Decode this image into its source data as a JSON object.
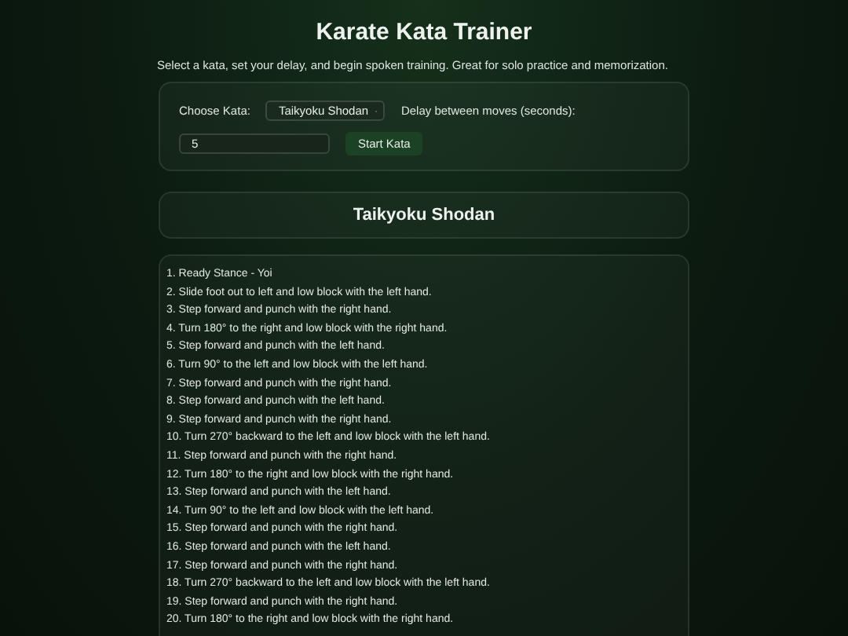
{
  "title": "Karate Kata Trainer",
  "subtitle": "Select a kata, set your delay, and begin spoken training. Great for solo practice and memorization.",
  "controls": {
    "kata_label": "Choose Kata:",
    "kata_value": "Taikyoku Shodan",
    "delay_label": "Delay between moves (seconds):",
    "delay_value": "5",
    "start_button": "Start Kata"
  },
  "kata_heading": "Taikyoku Shodan",
  "moves": [
    "1. Ready Stance - Yoi",
    "2. Slide foot out to left and low block with the left hand.",
    "3. Step forward and punch with the right hand.",
    "4. Turn 180° to the right and low block with the right hand.",
    "5. Step forward and punch with the left hand.",
    "6. Turn 90° to the left and low block with the left hand.",
    "7. Step forward and punch with the right hand.",
    "8. Step forward and punch with the left hand.",
    "9. Step forward and punch with the right hand.",
    "10. Turn 270° backward to the left and low block with the left hand.",
    "11. Step forward and punch with the right hand.",
    "12. Turn 180° to the right and low block with the right hand.",
    "13. Step forward and punch with the left hand.",
    "14. Turn 90° to the left and low block with the left hand.",
    "15. Step forward and punch with the right hand.",
    "16. Step forward and punch with the left hand.",
    "17. Step forward and punch with the right hand.",
    "18. Turn 270° backward to the left and low block with the left hand.",
    "19. Step forward and punch with the right hand.",
    "20. Turn 180° to the right and low block with the right hand."
  ]
}
